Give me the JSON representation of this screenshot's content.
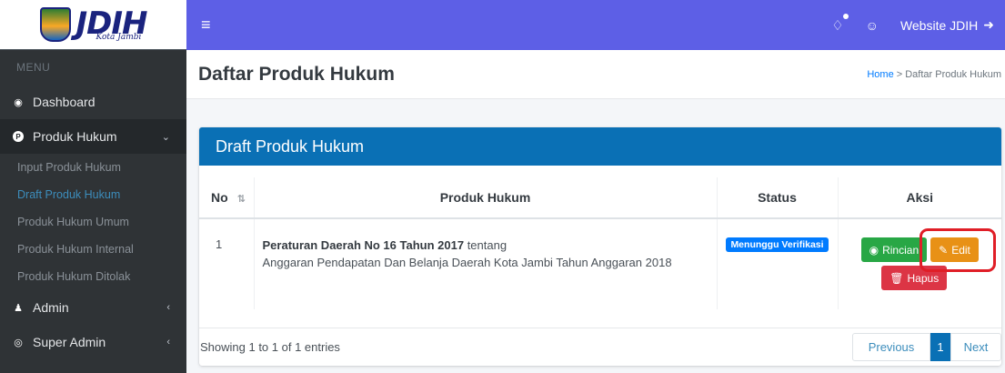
{
  "logo": {
    "main": "JDIH",
    "sub": "Kota Jambi"
  },
  "sidebar": {
    "menu_header": "MENU",
    "dashboard": "Dashboard",
    "produk_hukum": "Produk Hukum",
    "sub_items": [
      "Input Produk Hukum",
      "Draft Produk Hukum",
      "Produk Hukum Umum",
      "Produk Hukum Internal",
      "Produk Hukum Ditolak"
    ],
    "admin": "Admin",
    "super_admin": "Super Admin"
  },
  "topbar": {
    "site_link": "Website JDIH"
  },
  "header": {
    "title": "Daftar Produk Hukum",
    "breadcrumb_home": "Home",
    "breadcrumb_sep": " > ",
    "breadcrumb_current": "Daftar Produk Hukum"
  },
  "card": {
    "title": "Draft Produk Hukum",
    "columns": [
      "No",
      "Produk Hukum",
      "Status",
      "Aksi"
    ],
    "rows": [
      {
        "no": "1",
        "title_bold": "Peraturan Daerah No 16 Tahun 2017",
        "title_rest": " tentang",
        "description": "Anggaran Pendapatan Dan Belanja Daerah Kota Jambi Tahun Anggaran 2018",
        "status": "Menunggu Verifikasi",
        "btn_rincian": "Rincian",
        "btn_edit": "Edit",
        "btn_hapus": "Hapus"
      }
    ],
    "showing": "Showing 1 to 1 of 1 entries",
    "pager": {
      "previous": "Previous",
      "current": "1",
      "next": "Next"
    }
  },
  "colors": {
    "topbar": "#5d5fe6",
    "card_header": "#0a70b5",
    "sidebar": "#2f3336",
    "highlight": "#e01e27"
  }
}
